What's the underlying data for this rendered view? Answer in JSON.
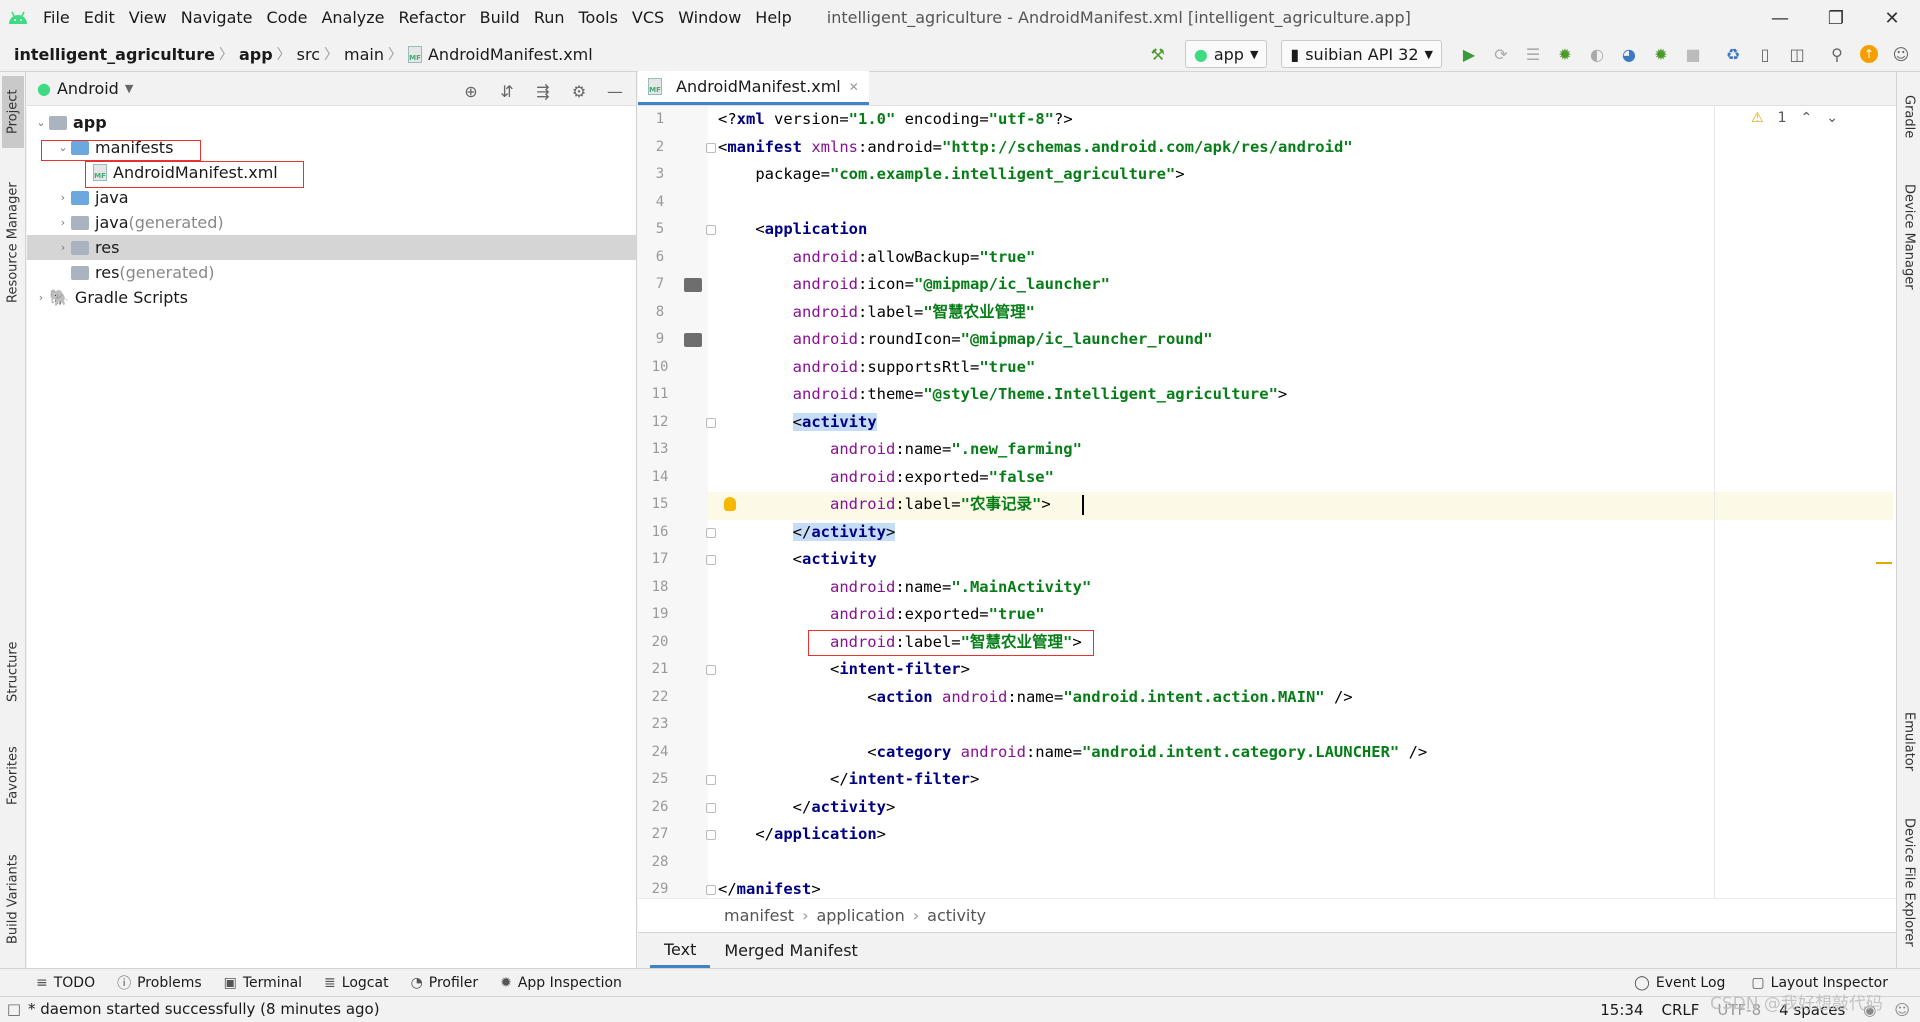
{
  "menubar": {
    "logo": "android-icon",
    "items": [
      "File",
      "Edit",
      "View",
      "Navigate",
      "Code",
      "Analyze",
      "Refactor",
      "Build",
      "Run",
      "Tools",
      "VCS",
      "Window",
      "Help"
    ],
    "title": "intelligent_agriculture - AndroidManifest.xml [intelligent_agriculture.app]"
  },
  "navbar": {
    "crumbs": [
      "intelligent_agriculture",
      "app",
      "src",
      "main",
      "AndroidManifest.xml"
    ],
    "run_config": "app",
    "device": "suibian API 32"
  },
  "left_stripe": {
    "project": "Project",
    "resource_manager": "Resource Manager",
    "structure": "Structure",
    "favorites": "Favorites",
    "build_variants": "Build Variants"
  },
  "right_stripe": {
    "gradle": "Gradle",
    "device_manager": "Device Manager",
    "emulator": "Emulator",
    "device_file_explorer": "Device File Explorer"
  },
  "project": {
    "view_mode": "Android",
    "tree": [
      {
        "label": "app",
        "extra": "",
        "level": 0
      },
      {
        "label": "manifests",
        "extra": "",
        "level": 1
      },
      {
        "label": "AndroidManifest.xml",
        "extra": "",
        "level": 2
      },
      {
        "label": "java",
        "extra": "",
        "level": 1
      },
      {
        "label": "java",
        "extra": " (generated)",
        "level": 1
      },
      {
        "label": "res",
        "extra": "",
        "level": 1
      },
      {
        "label": "res",
        "extra": " (generated)",
        "level": 1
      },
      {
        "label": "Gradle Scripts",
        "extra": "",
        "level": 0
      }
    ]
  },
  "editor": {
    "tab": "AndroidManifest.xml",
    "warning_count": "1",
    "line_numbers": [
      "1",
      "2",
      "3",
      "4",
      "5",
      "6",
      "7",
      "8",
      "9",
      "10",
      "11",
      "12",
      "13",
      "14",
      "15",
      "16",
      "17",
      "18",
      "19",
      "20",
      "21",
      "22",
      "23",
      "24",
      "25",
      "26",
      "27",
      "28",
      "29"
    ],
    "lines": [
      "<?xml version=\"1.0\" encoding=\"utf-8\"?>",
      "<manifest xmlns:android=\"http://schemas.android.com/apk/res/android\"",
      "    package=\"com.example.intelligent_agriculture\">",
      "",
      "    <application",
      "        android:allowBackup=\"true\"",
      "        android:icon=\"@mipmap/ic_launcher\"",
      "        android:label=\"智慧农业管理\"",
      "        android:roundIcon=\"@mipmap/ic_launcher_round\"",
      "        android:supportsRtl=\"true\"",
      "        android:theme=\"@style/Theme.Intelligent_agriculture\">",
      "        <activity",
      "            android:name=\".new_farming\"",
      "            android:exported=\"false\"",
      "            android:label=\"农事记录\">",
      "        </activity>",
      "        <activity",
      "            android:name=\".MainActivity\"",
      "            android:exported=\"true\"",
      "            android:label=\"智慧农业管理\">",
      "            <intent-filter>",
      "                <action android:name=\"android.intent.action.MAIN\" />",
      "",
      "                <category android:name=\"android.intent.category.LAUNCHER\" />",
      "            </intent-filter>",
      "        </activity>",
      "    </application>",
      "",
      "</manifest>"
    ],
    "breadcrumbs": [
      "manifest",
      "application",
      "activity"
    ],
    "bottom_tabs": [
      "Text",
      "Merged Manifest"
    ]
  },
  "tool_windows": {
    "left": [
      "TODO",
      "Problems",
      "Terminal",
      "Logcat",
      "Profiler",
      "App Inspection"
    ],
    "right": [
      "Event Log",
      "Layout Inspector"
    ]
  },
  "status": {
    "message": "* daemon started successfully (8 minutes ago)",
    "position": "15:34",
    "line_sep": "CRLF",
    "encoding": "UTF-8",
    "indent": "4 spaces"
  },
  "watermark": "CSDN @我好想敲代码",
  "colors": {
    "accent": "#4083c9",
    "highlight_box": "#e8322f",
    "string": "#067d17",
    "tag": "#000080",
    "namespace": "#871094"
  }
}
